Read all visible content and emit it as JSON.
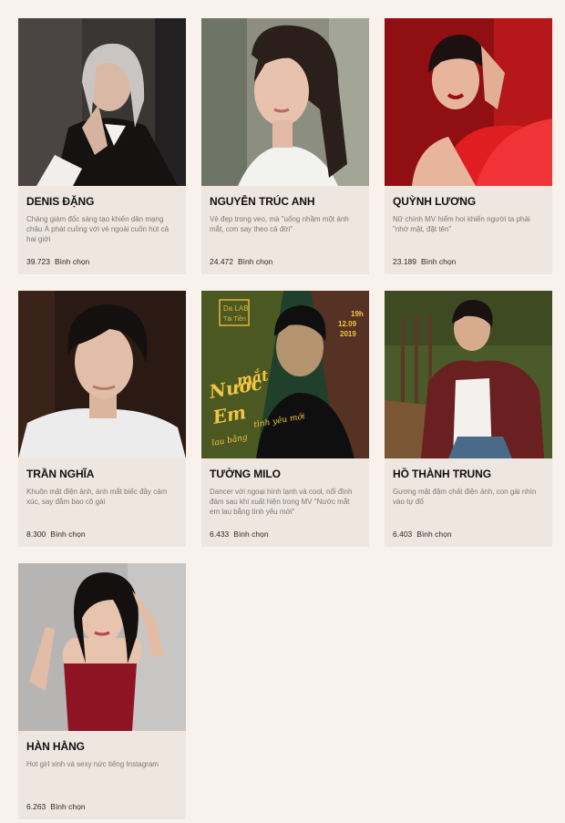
{
  "vote_label": "Bình chọn",
  "candidates": [
    {
      "name": "DENIS ĐẶNG",
      "description": "Chàng giám đốc sáng tạo khiến dân mạng châu Á phát cuồng với vẻ ngoài cuốn hút cả hai giới",
      "votes": "39.723",
      "photo_colors": {
        "bg": "#3a3634",
        "accent": "#141312",
        "skin": "#d9b9a6",
        "hair": "#c9c5c3"
      }
    },
    {
      "name": "NGUYỄN TRÚC ANH",
      "description": "Vẻ đẹp trong veo, mà \"uống nhầm một ánh mắt, cơn say theo cả đời\"",
      "votes": "24.472",
      "photo_colors": {
        "bg": "#8c8f80",
        "accent": "#f2f2ef",
        "skin": "#e8c2ad",
        "hair": "#2a1f1a"
      }
    },
    {
      "name": "QUỲNH LƯƠNG",
      "description": "Nữ chính MV hiếm hoi khiến người ta phải \"nhớ mặt, đặt tên\"",
      "votes": "23.189",
      "photo_colors": {
        "bg": "#8f0f12",
        "accent": "#e01d20",
        "skin": "#e7b59c",
        "hair": "#1d1010"
      }
    },
    {
      "name": "TRẦN NGHĨA",
      "description": "Khuôn mặt điện ảnh, ánh mắt biếc đầy cảm xúc, say đắm bao cô gái",
      "votes": "8.300",
      "photo_colors": {
        "bg": "#2b1a14",
        "accent": "#ececec",
        "skin": "#e2bea8",
        "hair": "#151010"
      }
    },
    {
      "name": "TƯỜNG MILO",
      "description": "Dancer với ngoại hình lạnh và cool, nổi đình đám sau khi xuất hiện trong MV \"Nước mắt em lau bằng tình yêu mới\"",
      "votes": "6.433",
      "photo_colors": {
        "bg": "#1f3b2e",
        "accent": "#e2b53a",
        "skin": "#b3946f",
        "hair": "#0f0f0f"
      }
    },
    {
      "name": "HỒ THÀNH TRUNG",
      "description": "Gương mặt đậm chất điện ảnh, con gái nhìn vào tự đổ",
      "votes": "6.403",
      "photo_colors": {
        "bg": "#4b5a2a",
        "accent": "#6a1f20",
        "skin": "#d8ab8e",
        "hair": "#191210"
      }
    },
    {
      "name": "HÀN HẰNG",
      "description": "Hot girl xinh và sexy nức tiếng Instagram",
      "votes": "6.263",
      "photo_colors": {
        "bg": "#b7b5b4",
        "accent": "#8e1424",
        "skin": "#e8c3ad",
        "hair": "#151010"
      }
    }
  ],
  "poster_text": {
    "brand_line1": "Da LAB",
    "brand_line2": "Tài Tiền",
    "time": "19h",
    "date": "12.09",
    "year": "2019",
    "script_line1": "Nước",
    "script_line2": "mắt",
    "script_line3": "Em",
    "script_line4": "lau bằng",
    "script_line5": "tình yêu mới"
  }
}
